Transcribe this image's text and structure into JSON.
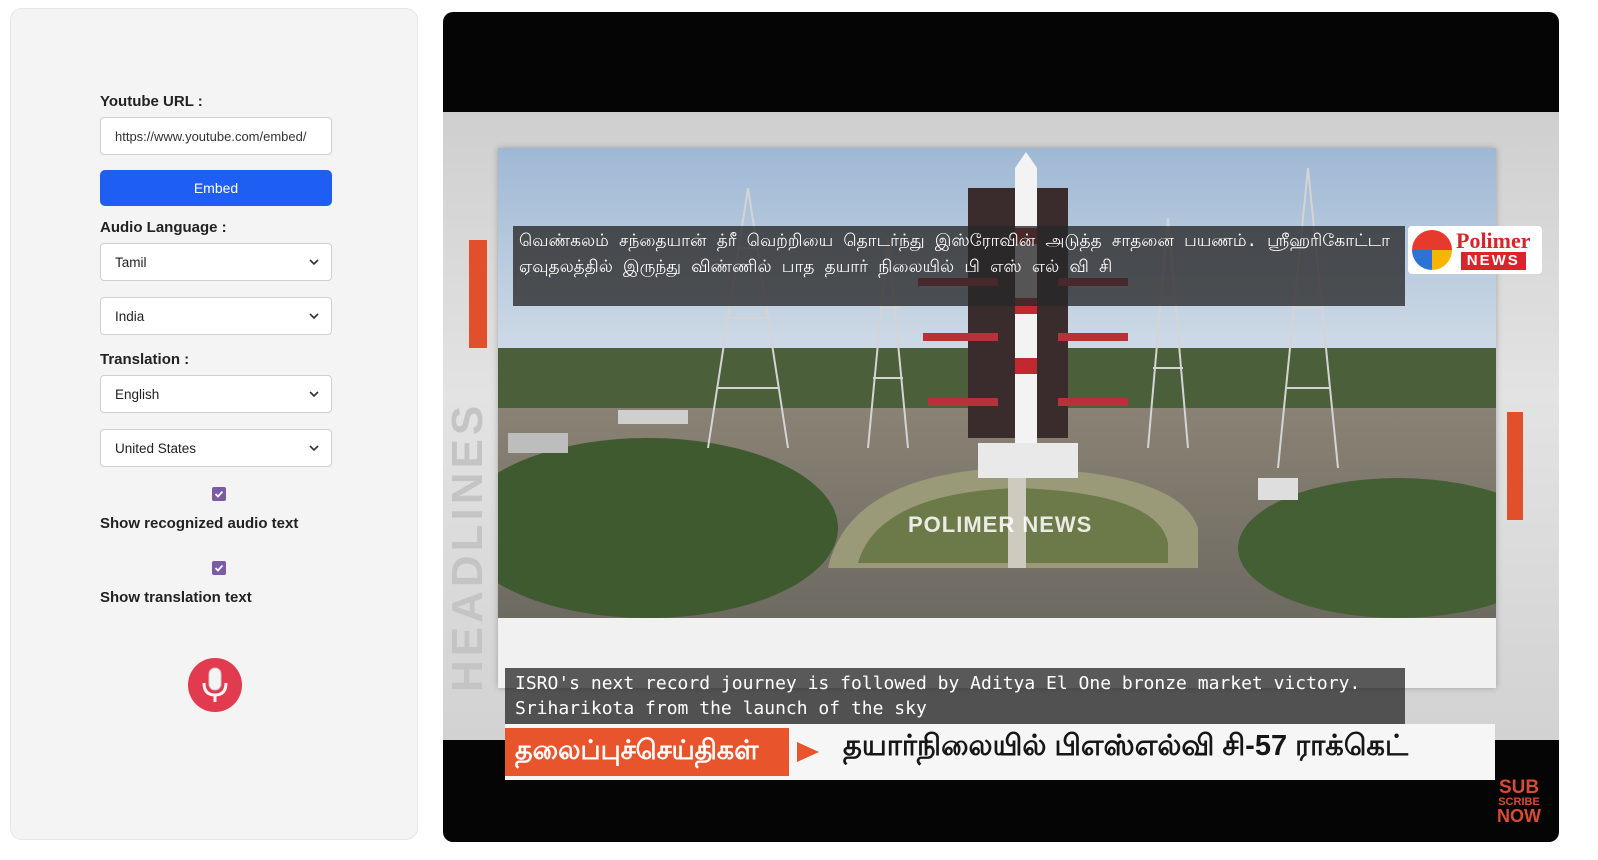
{
  "controls": {
    "url_label": "Youtube URL :",
    "url_value": "https://www.youtube.com/embed/",
    "embed_label": "Embed",
    "audio_label": "Audio Language :",
    "audio_language": "Tamil",
    "audio_region": "India",
    "translation_label": "Translation :",
    "translation_language": "English",
    "translation_region": "United States",
    "show_audio_label": "Show recognized audio text",
    "show_audio_checked": true,
    "show_translation_label": "Show translation text",
    "show_translation_checked": true,
    "mic_icon": "microphone-icon"
  },
  "video": {
    "caption_tamil": "வெண்கலம் சந்தையான் த்ரீ வெற்றியை தொடர்ந்து இஸ்ரோவின் அடுத்த சாதனை பயணம். ஸ்ரீஹரிகோட்டா ஏவுதலத்தில் இருந்து விண்ணில் பாத தயார் நிலையில் பி எஸ் எல் வி சி",
    "caption_english": "ISRO's next record journey is followed by Aditya El One bronze market victory. Sriharikota from the launch of the sky",
    "logo_top": "Polimer",
    "logo_bottom": "NEWS",
    "watermark": "POLIMER NEWS",
    "side_watermark": "HEADLINES",
    "lower_third_tag": "தலைப்புச்செய்திகள்",
    "lower_third_text": "தயார்நிலையில் பிஎஸ்எல்வி சி-57 ராக்கெட்",
    "subscribe_1": "SUB",
    "subscribe_2": "SCRIBE",
    "subscribe_3": "NOW"
  },
  "colors": {
    "accent_blue": "#1e5ef3",
    "checkbox_purple": "#7b5aa6",
    "mic_red": "#e23b4f",
    "news_orange": "#e8542c"
  }
}
